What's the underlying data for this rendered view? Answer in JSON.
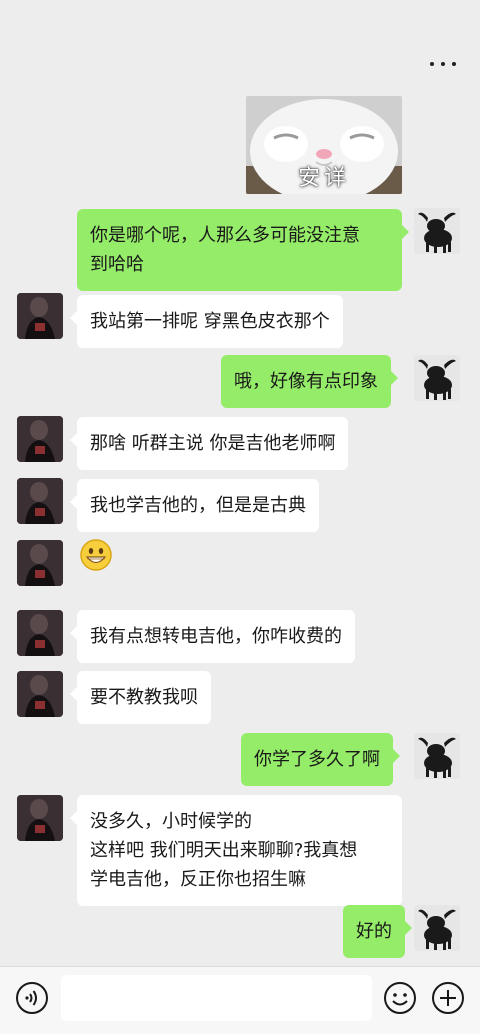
{
  "header": {
    "more_icon": "more-dots-icon"
  },
  "messages": [
    {
      "id": 1,
      "side": "out",
      "type": "sticker",
      "caption": "安详",
      "sticker_icon": "sleeping-white-cat"
    },
    {
      "id": 2,
      "side": "out",
      "type": "text",
      "lines": [
        "你是哪个呢，人那么多可能没注意",
        "到哈哈"
      ]
    },
    {
      "id": 3,
      "side": "in",
      "type": "text",
      "lines": [
        "我站第一排呢 穿黑色皮衣那个"
      ]
    },
    {
      "id": 4,
      "side": "out",
      "type": "text",
      "lines": [
        "哦，好像有点印象"
      ]
    },
    {
      "id": 5,
      "side": "in",
      "type": "text",
      "lines": [
        "那啥 听群主说 你是吉他老师啊"
      ]
    },
    {
      "id": 6,
      "side": "in",
      "type": "text",
      "lines": [
        "我也学吉他的，但是是古典"
      ]
    },
    {
      "id": 7,
      "side": "in",
      "type": "emoji",
      "emoji_icon": "grinning-face-emoji"
    },
    {
      "id": 8,
      "side": "in",
      "type": "text",
      "lines": [
        "我有点想转电吉他，你咋收费的"
      ]
    },
    {
      "id": 9,
      "side": "in",
      "type": "text",
      "lines": [
        "要不教教我呗"
      ]
    },
    {
      "id": 10,
      "side": "out",
      "type": "text",
      "lines": [
        "你学了多久了啊"
      ]
    },
    {
      "id": 11,
      "side": "in",
      "type": "text",
      "lines": [
        "没多久，小时候学的",
        "这样吧 我们明天出来聊聊?我真想",
        "学电吉他，反正你也招生嘛"
      ]
    },
    {
      "id": 12,
      "side": "out",
      "type": "text",
      "lines": [
        "好的"
      ]
    }
  ],
  "avatars": {
    "self": "goat-avatar",
    "other": "selfie-avatar"
  },
  "input_bar": {
    "voice_icon": "voice-icon",
    "emoji_icon": "smiley-icon",
    "plus_icon": "plus-icon",
    "input_value": ""
  },
  "colors": {
    "background": "#ededed",
    "outgoing_bubble": "#95ec69",
    "incoming_bubble": "#ffffff"
  }
}
